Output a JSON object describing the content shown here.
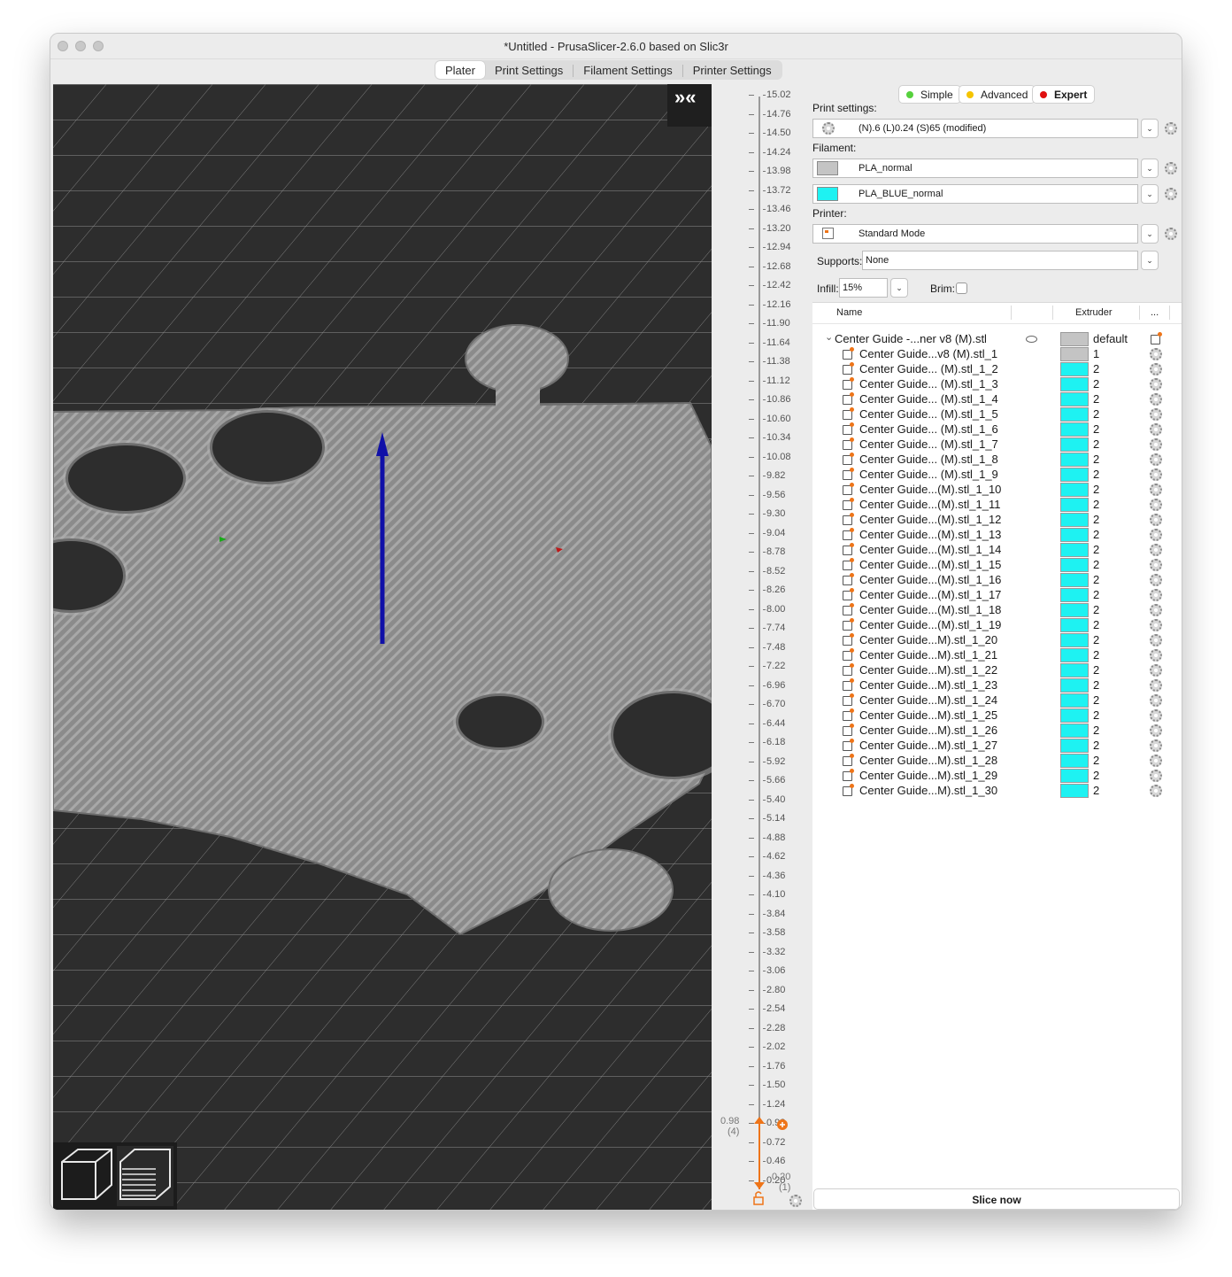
{
  "window": {
    "title": "*Untitled - PrusaSlicer-2.6.0 based on Slic3r"
  },
  "tabs": [
    {
      "label": "Plater",
      "active": true
    },
    {
      "label": "Print Settings",
      "active": false
    },
    {
      "label": "Filament Settings",
      "active": false
    },
    {
      "label": "Printer Settings",
      "active": false
    }
  ],
  "viewport": {
    "collapse_label": "»«"
  },
  "layer_slider": {
    "ticks": [
      "15.02",
      "14.76",
      "14.50",
      "14.24",
      "13.98",
      "13.72",
      "13.46",
      "13.20",
      "12.94",
      "12.68",
      "12.42",
      "12.16",
      "11.90",
      "11.64",
      "11.38",
      "11.12",
      "10.86",
      "10.60",
      "10.34",
      "10.08",
      "9.82",
      "9.56",
      "9.30",
      "9.04",
      "8.78",
      "8.52",
      "8.26",
      "8.00",
      "7.74",
      "7.48",
      "7.22",
      "6.96",
      "6.70",
      "6.44",
      "6.18",
      "5.92",
      "5.66",
      "5.40",
      "5.14",
      "4.88",
      "4.62",
      "4.36",
      "4.10",
      "3.84",
      "3.58",
      "3.32",
      "3.06",
      "2.80",
      "2.54",
      "2.28",
      "2.02",
      "1.76",
      "1.50",
      "1.24",
      "0.98",
      "0.72",
      "0.46",
      "0.20"
    ],
    "upper_value": "0.98",
    "upper_layer": "(4)",
    "lower_value": "0.20",
    "lower_layer": "(1)"
  },
  "modes": {
    "simple": "Simple",
    "advanced": "Advanced",
    "expert": "Expert",
    "colors": {
      "simple": "#56d13d",
      "advanced": "#f5c400",
      "expert": "#e01010"
    }
  },
  "settings": {
    "print_label": "Print settings:",
    "print_value": "(N).6 (L)0.24 (S)65 (modified)",
    "filament_label": "Filament:",
    "filaments": [
      {
        "name": "PLA_normal",
        "color": "#c4c4c4"
      },
      {
        "name": "PLA_BLUE_normal",
        "color": "#1ef2f2"
      }
    ],
    "printer_label": "Printer:",
    "printer_value": "Standard Mode",
    "supports_label": "Supports:",
    "supports_value": "None",
    "infill_label": "Infill:",
    "infill_value": "15%",
    "brim_label": "Brim:",
    "brim_checked": false
  },
  "object_list": {
    "headers": {
      "name": "Name",
      "extruder": "Extruder",
      "more": "..."
    },
    "object": {
      "name": "Center Guide -...ner v8 (M).stl",
      "extruder": "default",
      "color": "#c4c4c4"
    },
    "parts": [
      {
        "name": "Center Guide...v8 (M).stl_1",
        "extruder": "1",
        "color": "#c4c4c4"
      },
      {
        "name": "Center Guide... (M).stl_1_2",
        "extruder": "2",
        "color": "#1ef2f2"
      },
      {
        "name": "Center Guide... (M).stl_1_3",
        "extruder": "2",
        "color": "#1ef2f2"
      },
      {
        "name": "Center Guide... (M).stl_1_4",
        "extruder": "2",
        "color": "#1ef2f2"
      },
      {
        "name": "Center Guide... (M).stl_1_5",
        "extruder": "2",
        "color": "#1ef2f2"
      },
      {
        "name": "Center Guide... (M).stl_1_6",
        "extruder": "2",
        "color": "#1ef2f2"
      },
      {
        "name": "Center Guide... (M).stl_1_7",
        "extruder": "2",
        "color": "#1ef2f2"
      },
      {
        "name": "Center Guide... (M).stl_1_8",
        "extruder": "2",
        "color": "#1ef2f2"
      },
      {
        "name": "Center Guide... (M).stl_1_9",
        "extruder": "2",
        "color": "#1ef2f2"
      },
      {
        "name": "Center Guide...(M).stl_1_10",
        "extruder": "2",
        "color": "#1ef2f2"
      },
      {
        "name": "Center Guide...(M).stl_1_11",
        "extruder": "2",
        "color": "#1ef2f2"
      },
      {
        "name": "Center Guide...(M).stl_1_12",
        "extruder": "2",
        "color": "#1ef2f2"
      },
      {
        "name": "Center Guide...(M).stl_1_13",
        "extruder": "2",
        "color": "#1ef2f2"
      },
      {
        "name": "Center Guide...(M).stl_1_14",
        "extruder": "2",
        "color": "#1ef2f2"
      },
      {
        "name": "Center Guide...(M).stl_1_15",
        "extruder": "2",
        "color": "#1ef2f2"
      },
      {
        "name": "Center Guide...(M).stl_1_16",
        "extruder": "2",
        "color": "#1ef2f2"
      },
      {
        "name": "Center Guide...(M).stl_1_17",
        "extruder": "2",
        "color": "#1ef2f2"
      },
      {
        "name": "Center Guide...(M).stl_1_18",
        "extruder": "2",
        "color": "#1ef2f2"
      },
      {
        "name": "Center Guide...(M).stl_1_19",
        "extruder": "2",
        "color": "#1ef2f2"
      },
      {
        "name": "Center Guide...M).stl_1_20",
        "extruder": "2",
        "color": "#1ef2f2"
      },
      {
        "name": "Center Guide...M).stl_1_21",
        "extruder": "2",
        "color": "#1ef2f2"
      },
      {
        "name": "Center Guide...M).stl_1_22",
        "extruder": "2",
        "color": "#1ef2f2"
      },
      {
        "name": "Center Guide...M).stl_1_23",
        "extruder": "2",
        "color": "#1ef2f2"
      },
      {
        "name": "Center Guide...M).stl_1_24",
        "extruder": "2",
        "color": "#1ef2f2"
      },
      {
        "name": "Center Guide...M).stl_1_25",
        "extruder": "2",
        "color": "#1ef2f2"
      },
      {
        "name": "Center Guide...M).stl_1_26",
        "extruder": "2",
        "color": "#1ef2f2"
      },
      {
        "name": "Center Guide...M).stl_1_27",
        "extruder": "2",
        "color": "#1ef2f2"
      },
      {
        "name": "Center Guide...M).stl_1_28",
        "extruder": "2",
        "color": "#1ef2f2"
      },
      {
        "name": "Center Guide...M).stl_1_29",
        "extruder": "2",
        "color": "#1ef2f2"
      },
      {
        "name": "Center Guide...M).stl_1_30",
        "extruder": "2",
        "color": "#1ef2f2"
      }
    ]
  },
  "slice_button": "Slice now"
}
